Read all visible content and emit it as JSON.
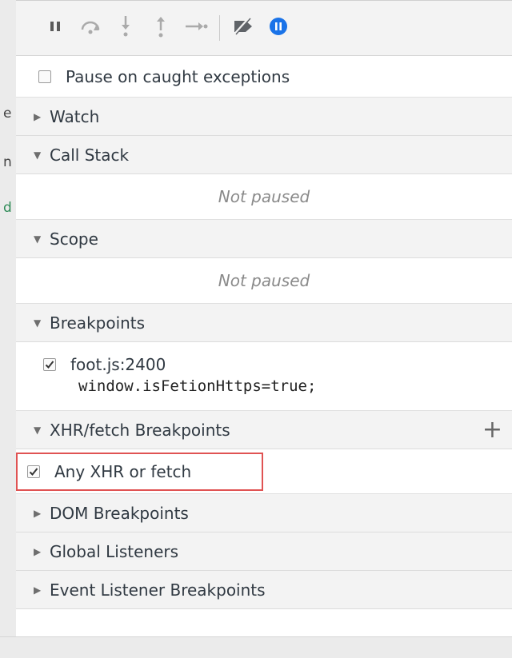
{
  "toolbar": {
    "buttons": [
      {
        "icon": "pause-icon"
      },
      {
        "icon": "step-over-icon"
      },
      {
        "icon": "step-into-icon"
      },
      {
        "icon": "step-out-icon"
      },
      {
        "icon": "step-icon"
      },
      {
        "icon": "deactivate-breakpoints-icon"
      },
      {
        "icon": "pause-on-exceptions-icon"
      }
    ],
    "accent_color": "#1a73e8"
  },
  "pause_on_caught": {
    "label": "Pause on caught exceptions",
    "checked": false
  },
  "sections": {
    "watch": {
      "label": "Watch",
      "expanded": false
    },
    "call_stack": {
      "label": "Call Stack",
      "expanded": true,
      "status": "Not paused"
    },
    "scope": {
      "label": "Scope",
      "expanded": true,
      "status": "Not paused"
    },
    "breakpoints": {
      "label": "Breakpoints",
      "expanded": true,
      "items": [
        {
          "location": "foot.js:2400",
          "code": "window.isFetionHttps=true;",
          "checked": true
        }
      ]
    },
    "xhr": {
      "label": "XHR/fetch Breakpoints",
      "expanded": true,
      "add_symbol": "+",
      "items": [
        {
          "label": "Any XHR or fetch",
          "checked": true
        }
      ],
      "highlight_color": "#e05353"
    },
    "dom": {
      "label": "DOM Breakpoints",
      "expanded": false
    },
    "global": {
      "label": "Global Listeners",
      "expanded": false
    },
    "event": {
      "label": "Event Listener Breakpoints",
      "expanded": false
    }
  },
  "left_fragments": [
    "e",
    "n",
    "d"
  ]
}
